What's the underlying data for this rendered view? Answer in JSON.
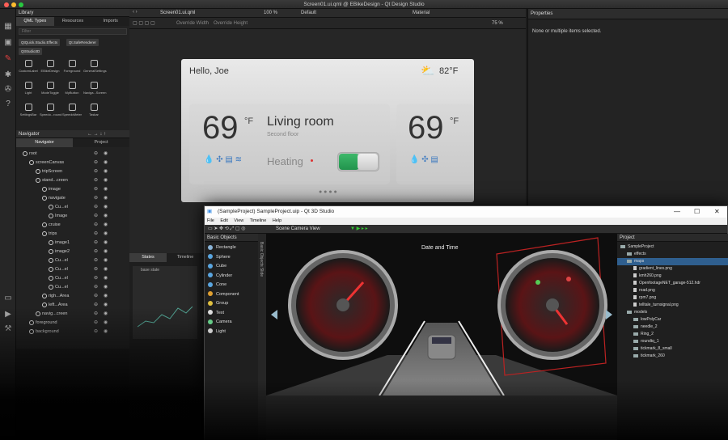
{
  "window": {
    "title": "Screen01.ui.qml @ EBikeDesign - Qt Design Studio"
  },
  "library": {
    "header": "Library",
    "tabs": [
      "QML Types",
      "Resources",
      "Imports"
    ],
    "filter_placeholder": "Filter",
    "modules": [
      "QtQuick.Studio.Effects",
      "Qt.SafeRenderer",
      "QtStudio3D"
    ],
    "components": [
      {
        "name": "CustomLabel"
      },
      {
        "name": "EBikeDesign"
      },
      {
        "name": "Foreground"
      },
      {
        "name": "GeneralSettings"
      },
      {
        "name": ""
      },
      {
        "name": "Light"
      },
      {
        "name": "ModeToggle"
      },
      {
        "name": "MyButton"
      },
      {
        "name": "Naviga...Screen"
      },
      {
        "name": ""
      },
      {
        "name": "SettingsBar"
      },
      {
        "name": "Speedo...round"
      },
      {
        "name": "SpeedoMeter"
      },
      {
        "name": "Taskar"
      },
      {
        "name": ""
      }
    ]
  },
  "navigator": {
    "header": "Navigator",
    "tabs": [
      "Navigator",
      "Project"
    ],
    "items": [
      {
        "name": "root",
        "indent": 0
      },
      {
        "name": "screenCanvas",
        "indent": 1
      },
      {
        "name": "tripScreen",
        "indent": 2
      },
      {
        "name": "stand...creen",
        "indent": 2
      },
      {
        "name": "image",
        "indent": 3
      },
      {
        "name": "navigate",
        "indent": 3
      },
      {
        "name": "Cu...el",
        "indent": 4
      },
      {
        "name": "Image",
        "indent": 4
      },
      {
        "name": "cruise",
        "indent": 3
      },
      {
        "name": "trips",
        "indent": 3
      },
      {
        "name": "image1",
        "indent": 4
      },
      {
        "name": "image2",
        "indent": 4
      },
      {
        "name": "Cu...el",
        "indent": 4
      },
      {
        "name": "Cu...el",
        "indent": 4
      },
      {
        "name": "Cu...el",
        "indent": 4
      },
      {
        "name": "Cu...el",
        "indent": 4
      },
      {
        "name": "righ...Area",
        "indent": 3
      },
      {
        "name": "left...Area",
        "indent": 3
      },
      {
        "name": "navig...creen",
        "indent": 2
      },
      {
        "name": "foreground",
        "indent": 1
      },
      {
        "name": "background",
        "indent": 1
      }
    ]
  },
  "editor": {
    "file": "Screen01.ui.qml",
    "zoom": "100 %",
    "style": "Default",
    "theme": "Material",
    "zoom2": "75 %",
    "override_width": "Override Width",
    "override_height": "Override Height"
  },
  "properties": {
    "header": "Properties",
    "empty": "None or multiple items selected."
  },
  "ebike": {
    "greeting": "Hello, Joe",
    "weather_temp": "82°F",
    "temp_value": "69",
    "temp_unit": "°F",
    "room": "Living room",
    "floor": "Second floor",
    "mode": "Heating",
    "temp_value2": "69",
    "temp_unit2": "°F"
  },
  "states": {
    "tabs": [
      "States",
      "Timeline"
    ],
    "base_state": "base state"
  },
  "studio3d": {
    "title": "(SampleProject) SampleProject.uip - Qt 3D Studio",
    "menu": [
      "File",
      "Edit",
      "View",
      "Timeline",
      "Help"
    ],
    "camera": "Scene Camera View",
    "basic_header": "Basic Objects",
    "side_tabs": "Basic Objects    Slide",
    "objects": [
      "Rectangle",
      "Sphere",
      "Cube",
      "Cylinder",
      "Cone",
      "Component",
      "Group",
      "Text",
      "Camera",
      "Light"
    ],
    "object_colors": [
      "#8ab4d8",
      "#5aa6e0",
      "#5aa6e0",
      "#5aa6e0",
      "#5aa6e0",
      "#e0a030",
      "#e0c040",
      "#ddd",
      "#6c8",
      "#ccc"
    ],
    "viewport_title": "Date and Time",
    "project_header": "Project",
    "project_items": [
      {
        "name": "SampleProject",
        "indent": 0,
        "type": "folder",
        "selected": false
      },
      {
        "name": "effects",
        "indent": 1,
        "type": "folder",
        "selected": false
      },
      {
        "name": "maps",
        "indent": 1,
        "type": "folder",
        "selected": true
      },
      {
        "name": "gradient_lines.png",
        "indent": 2,
        "type": "file",
        "selected": false
      },
      {
        "name": "kmh260.png",
        "indent": 2,
        "type": "file",
        "selected": false
      },
      {
        "name": "OpenfootageNET_garage-512.hdr",
        "indent": 2,
        "type": "file",
        "selected": false
      },
      {
        "name": "road.png",
        "indent": 2,
        "type": "file",
        "selected": false
      },
      {
        "name": "rpm7.png",
        "indent": 2,
        "type": "file",
        "selected": false
      },
      {
        "name": "telltale_turnsignal.png",
        "indent": 2,
        "type": "file",
        "selected": false
      },
      {
        "name": "models",
        "indent": 1,
        "type": "folder",
        "selected": false
      },
      {
        "name": "lowPolyCar",
        "indent": 2,
        "type": "folder",
        "selected": false
      },
      {
        "name": "needle_2",
        "indent": 2,
        "type": "folder",
        "selected": false
      },
      {
        "name": "Ring_2",
        "indent": 2,
        "type": "folder",
        "selected": false
      },
      {
        "name": "roundtq_1",
        "indent": 2,
        "type": "folder",
        "selected": false
      },
      {
        "name": "tickmark_8_small",
        "indent": 2,
        "type": "folder",
        "selected": false
      },
      {
        "name": "tickmark_260",
        "indent": 2,
        "type": "folder",
        "selected": false
      }
    ]
  }
}
